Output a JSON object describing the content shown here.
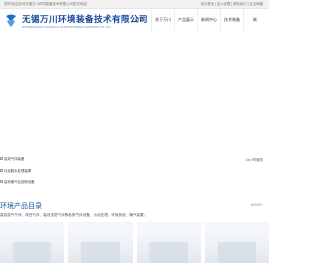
{
  "topbar": {
    "welcome": "您好!欢迎访问无锡万川环境装备技术有限公司官方网站!",
    "links": "设为首页 | 加入收藏 | 联系我们 | 企业邮箱"
  },
  "brand": {
    "name_cn": "无锡万川环境装备技术有限公司",
    "name_en": "WUXIWANCHUAN TECHNICAL OF ENVIRONMENT EQUIPMENT CO.,LTD."
  },
  "nav": {
    "items": [
      "首页",
      "关于万川",
      "产品展示",
      "新闻中心",
      "技术装备",
      "联"
    ]
  },
  "side": {
    "items": [
      "高效气浮装备",
      "污泥脱水处理装置",
      "高效曝气及回转设备"
    ],
    "hotline": "24小时服务"
  },
  "products_section": {
    "title": "环境产品目录",
    "more": "MORE+",
    "desc": "高效溶气气浮、涡凹气浮、高效浅层气浮等各类气浮设备，污泥处理、环保系统、曝气装置。"
  },
  "colors": {
    "brand_blue": "#16479a",
    "accent_blue": "#1a5aa6"
  }
}
